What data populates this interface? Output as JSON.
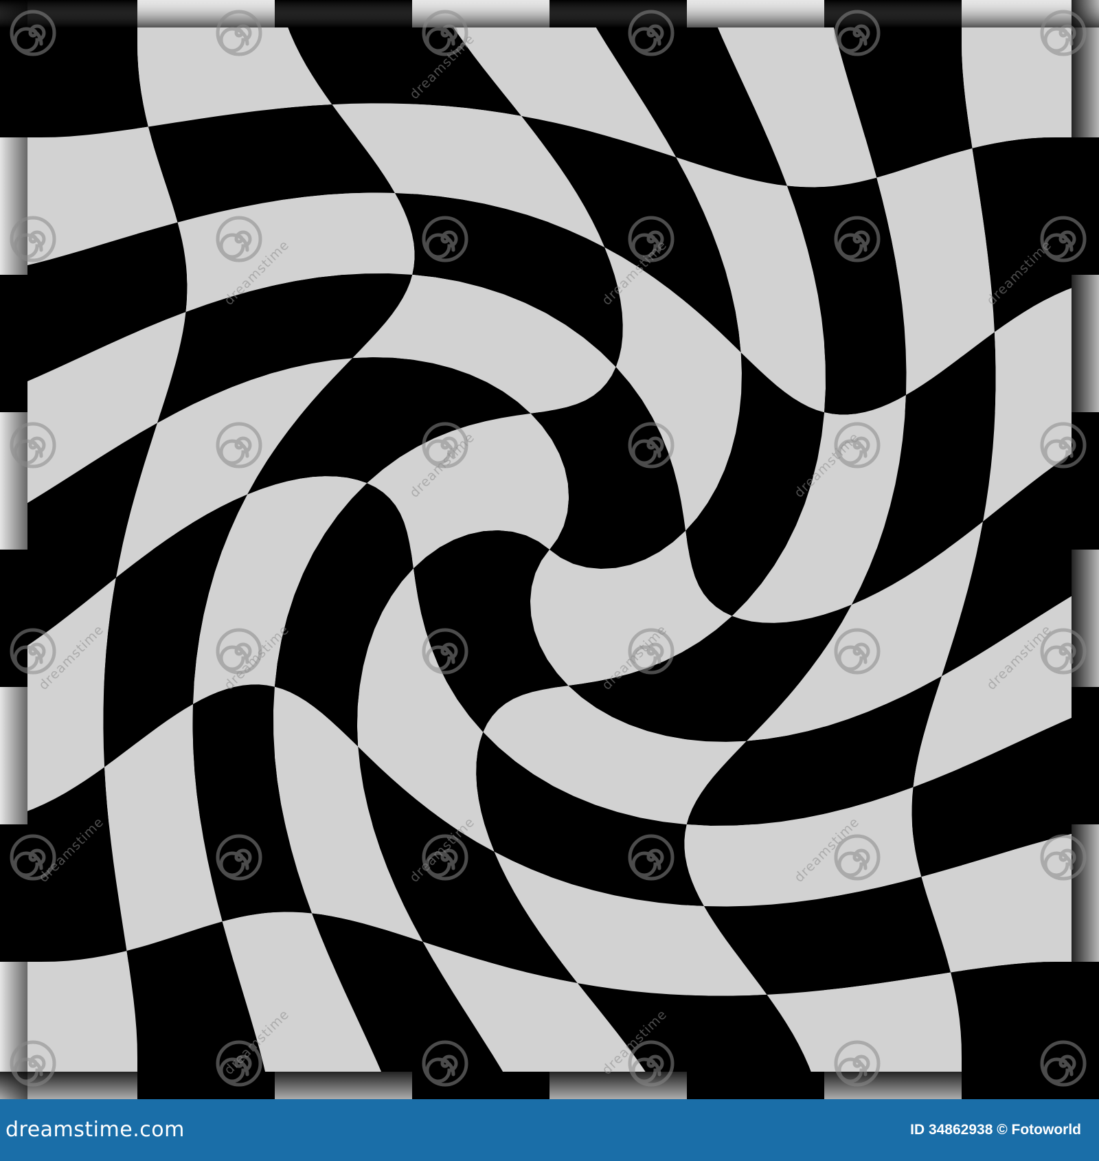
{
  "artwork": {
    "description_colors": {
      "dark": "#000000",
      "light": "#d2d2d2",
      "frame_light": "#e6e6e6",
      "frame_dark": "#000000"
    }
  },
  "watermark": {
    "text": "dreamstime",
    "icon": "spiral-icon"
  },
  "footer": {
    "background": "#1a6ea8",
    "logo_text": "dreamstime.com",
    "image_id": "ID 34862938 © Fotoworld"
  }
}
